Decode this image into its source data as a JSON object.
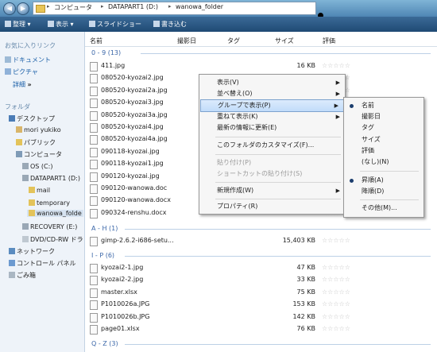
{
  "address": {
    "crumbs": [
      "コンピュータ",
      "DATAPART1 (D:)",
      "wanowa_folder"
    ]
  },
  "toolbar": {
    "organize": "整理",
    "views": "表示",
    "slideshow": "スライドショー",
    "burn": "書き込む"
  },
  "sidebar": {
    "favorites_header": "お気に入りリンク",
    "favorites": [
      "ドキュメント",
      "ピクチャ"
    ],
    "more": "詳細",
    "folders_header": "フォルダ",
    "tree": [
      "デスクトップ",
      "mori yukiko",
      "パブリック",
      "コンピュータ",
      "OS (C:)",
      "DATAPART1 (D:)",
      "mail",
      "temporary",
      "wanowa_folde",
      "RECOVERY (E:)",
      "DVD/CD-RW ドラ",
      "ネットワーク",
      "コントロール パネル",
      "ごみ箱"
    ]
  },
  "columns": [
    "名前",
    "撮影日",
    "タグ",
    "サイズ",
    "評価"
  ],
  "groups": {
    "g1": "0 - 9 (13)",
    "g2": "A - H (1)",
    "g3": "I - P (6)",
    "g4": "Q - Z (3)"
  },
  "files_g1": [
    {
      "name": "411.jpg",
      "size": "16 KB"
    },
    {
      "name": "080520-kyozai2.jpg",
      "size": ""
    },
    {
      "name": "080520-kyozai2a.jpg",
      "size": ""
    },
    {
      "name": "080520-kyozai3.jpg",
      "size": ""
    },
    {
      "name": "080520-kyozai3a.jpg",
      "size": ""
    },
    {
      "name": "080520-kyozai4.jpg",
      "size": ""
    },
    {
      "name": "080520-kyozai4a.jpg",
      "size": ""
    },
    {
      "name": "090118-kyozai.jpg",
      "size": ""
    },
    {
      "name": "090118-kyozai1.jpg",
      "size": ""
    },
    {
      "name": "090120-kyozai.jpg",
      "size": ""
    },
    {
      "name": "090120-wanowa.doc",
      "size": ""
    },
    {
      "name": "090120-wanowa.docx",
      "size": ""
    },
    {
      "name": "090324-renshu.docx",
      "size": ""
    }
  ],
  "files_g2": [
    {
      "name": "gimp-2.6.2-i686-setu...",
      "size": "15,403 KB"
    }
  ],
  "files_g3": [
    {
      "name": "kyozai2-1.jpg",
      "size": "47 KB"
    },
    {
      "name": "kyozai2-2.jpg",
      "size": "33 KB"
    },
    {
      "name": "master.xlsx",
      "size": "75 KB"
    },
    {
      "name": "P1010026a.JPG",
      "size": "153 KB"
    },
    {
      "name": "P1010026b.JPG",
      "size": "142 KB"
    },
    {
      "name": "page01.xlsx",
      "size": "76 KB"
    }
  ],
  "stars": "☆☆☆☆☆",
  "context_menu": {
    "items": [
      "表示(V)",
      "並べ替え(O)",
      "グループで表示(P)",
      "重ねて表示(K)",
      "最新の情報に更新(E)",
      "このフォルダのカスタマイズ(F)...",
      "貼り付け(P)",
      "ショートカットの貼り付け(S)",
      "新規作成(W)",
      "プロパティ(R)"
    ]
  },
  "submenu": {
    "items": [
      "名前",
      "撮影日",
      "タグ",
      "サイズ",
      "評価",
      "(なし)(N)",
      "昇順(A)",
      "降順(D)",
      "その他(M)..."
    ]
  },
  "colors": {
    "accent": "#3a66a8",
    "toolbar": "#2a5785",
    "highlight": "#c1dcfa"
  }
}
